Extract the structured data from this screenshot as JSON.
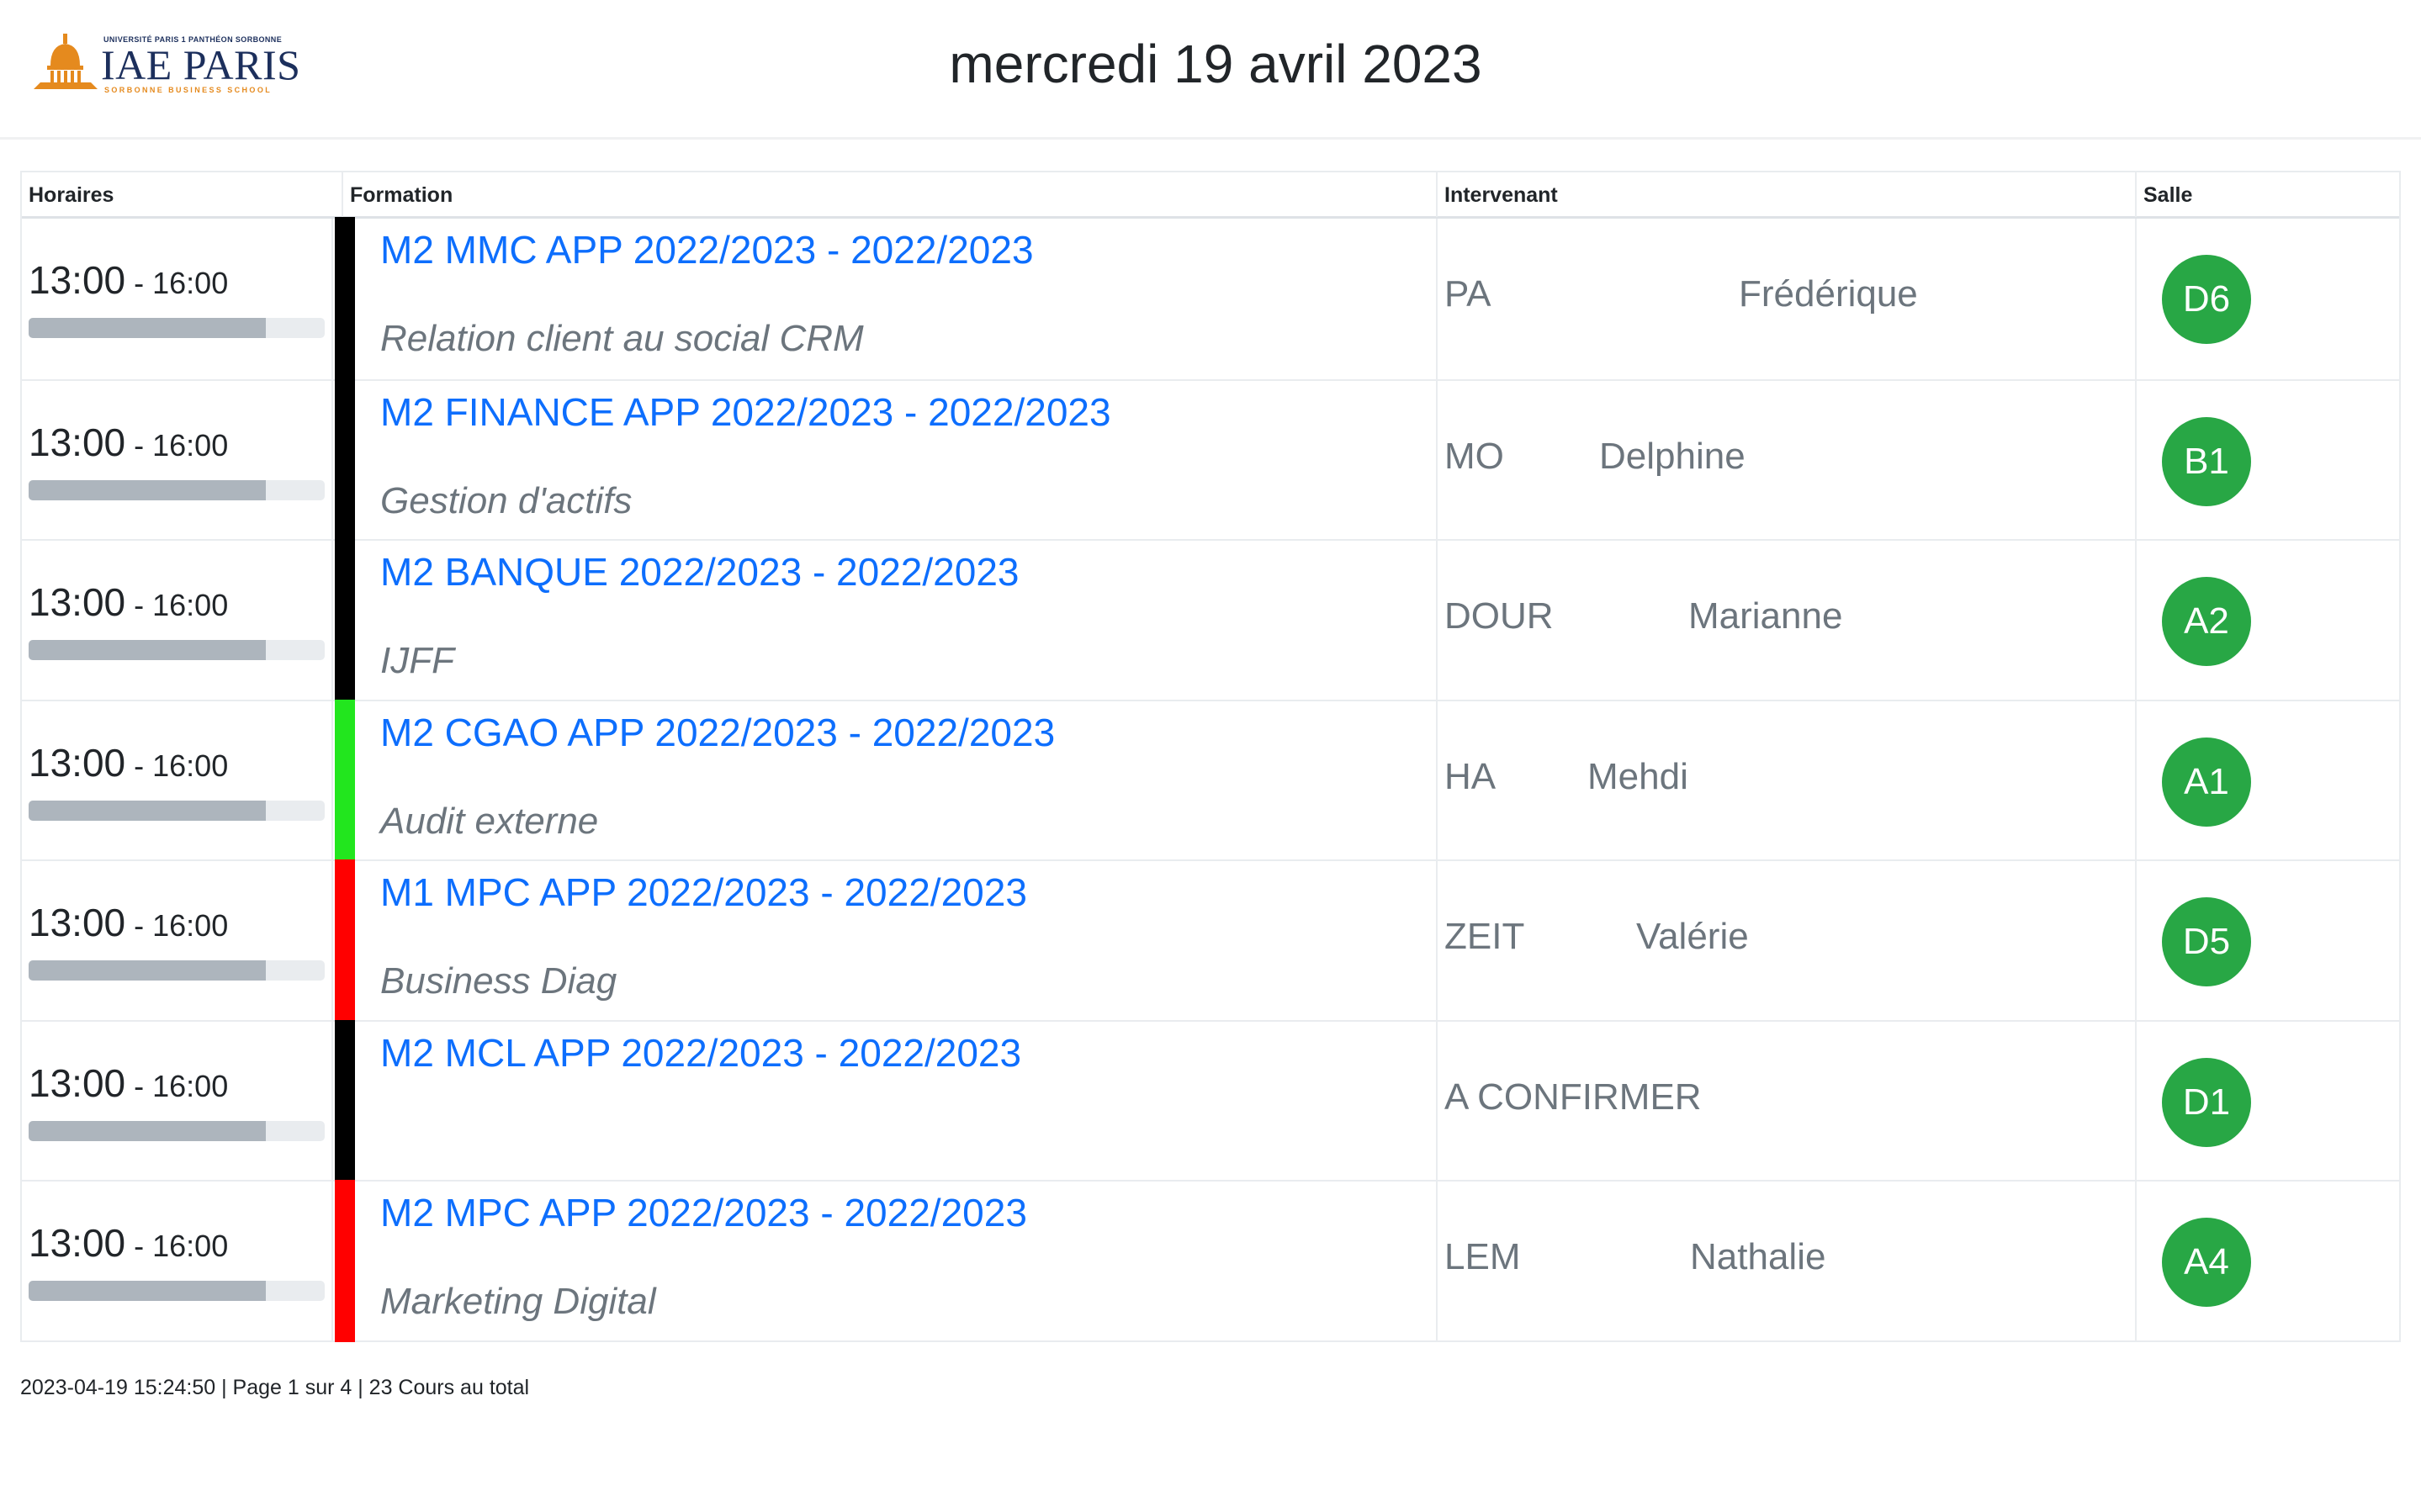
{
  "logo": {
    "university": "UNIVERSITÉ PARIS 1 PANTHÉON SORBONNE",
    "name": "IAE PARIS",
    "school": "SORBONNE BUSINESS SCHOOL"
  },
  "header": {
    "title": "mercredi 19 avril 2023"
  },
  "table": {
    "columns": {
      "horaires": "Horaires",
      "formation": "Formation",
      "intervenant": "Intervenant",
      "salle": "Salle"
    },
    "rows": [
      {
        "start": "13:00",
        "sep": " - ",
        "end": "16:00",
        "progress": 0.8,
        "color": "#000000",
        "formation": "M2 MMC APP 2022/2023 - 2022/2023",
        "subject": "Relation client au social CRM",
        "lastname": "PA",
        "firstname": "Frédérique",
        "room": "D6"
      },
      {
        "start": "13:00",
        "sep": " - ",
        "end": "16:00",
        "progress": 0.8,
        "color": "#000000",
        "formation": "M2 FINANCE APP 2022/2023 - 2022/2023",
        "subject": "Gestion d'actifs",
        "lastname": "MO",
        "firstname": "Delphine",
        "room": "B1"
      },
      {
        "start": "13:00",
        "sep": " - ",
        "end": "16:00",
        "progress": 0.8,
        "color": "#000000",
        "formation": "M2 BANQUE 2022/2023 - 2022/2023",
        "subject": "IJFF",
        "lastname": "DOUR",
        "firstname": "Marianne",
        "room": "A2"
      },
      {
        "start": "13:00",
        "sep": " - ",
        "end": "16:00",
        "progress": 0.8,
        "color": "#22e61e",
        "formation": "M2 CGAO APP 2022/2023 - 2022/2023",
        "subject": "Audit externe",
        "lastname": "HA",
        "firstname": "Mehdi",
        "room": "A1"
      },
      {
        "start": "13:00",
        "sep": " - ",
        "end": "16:00",
        "progress": 0.8,
        "color": "#ff0000",
        "formation": "M1 MPC APP 2022/2023 - 2022/2023",
        "subject": "Business Diag",
        "lastname": "ZEIT",
        "firstname": "Valérie",
        "room": "D5"
      },
      {
        "start": "13:00",
        "sep": " - ",
        "end": "16:00",
        "progress": 0.8,
        "color": "#000000",
        "formation": "M2 MCL APP 2022/2023 - 2022/2023",
        "subject": "",
        "lastname": "A CONFIRMER",
        "firstname": "",
        "room": "D1"
      },
      {
        "start": "13:00",
        "sep": " - ",
        "end": "16:00",
        "progress": 0.8,
        "color": "#ff0000",
        "formation": "M2 MPC APP 2022/2023 - 2022/2023",
        "subject": "Marketing Digital",
        "lastname": "LEM",
        "firstname": "Nathalie",
        "room": "A4"
      }
    ]
  },
  "footer": {
    "text": "2023-04-19 15:24:50 | Page 1 sur 4 | 23 Cours au total"
  },
  "colors": {
    "link": "#0d6efd",
    "muted": "#6c757d",
    "badge": "#28a745"
  }
}
